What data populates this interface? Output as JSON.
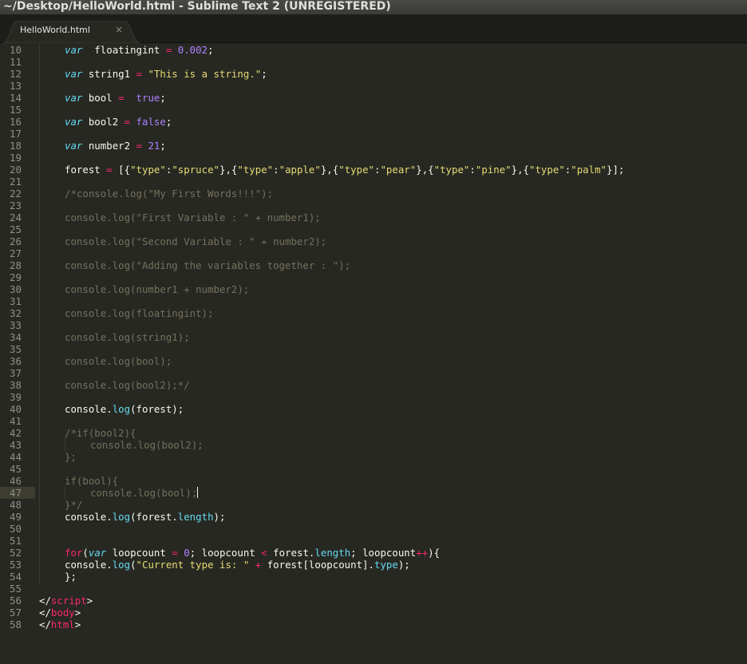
{
  "window": {
    "title": "~/Desktop/HelloWorld.html - Sublime Text 2 (UNREGISTERED)"
  },
  "tabs": [
    {
      "label": "HelloWorld.html",
      "close": "×"
    }
  ],
  "editor": {
    "active_line": 47,
    "lines": [
      {
        "n": "10",
        "indent": 1,
        "tokens": [
          [
            "kw-i",
            "var"
          ],
          [
            "",
            "  floatingint "
          ],
          [
            "op",
            "="
          ],
          [
            "",
            " "
          ],
          [
            "num",
            "0.002"
          ],
          [
            "",
            ";"
          ]
        ]
      },
      {
        "n": "11",
        "indent": 1,
        "tokens": []
      },
      {
        "n": "12",
        "indent": 1,
        "tokens": [
          [
            "kw-i",
            "var"
          ],
          [
            "",
            " string1 "
          ],
          [
            "op",
            "="
          ],
          [
            "",
            " "
          ],
          [
            "str",
            "\"This is a string.\""
          ],
          [
            "",
            ";"
          ]
        ]
      },
      {
        "n": "13",
        "indent": 1,
        "tokens": []
      },
      {
        "n": "14",
        "indent": 1,
        "tokens": [
          [
            "kw-i",
            "var"
          ],
          [
            "",
            " bool "
          ],
          [
            "op",
            "="
          ],
          [
            "",
            "  "
          ],
          [
            "con",
            "true"
          ],
          [
            "",
            ";"
          ]
        ]
      },
      {
        "n": "15",
        "indent": 1,
        "tokens": []
      },
      {
        "n": "16",
        "indent": 1,
        "tokens": [
          [
            "kw-i",
            "var"
          ],
          [
            "",
            " bool2 "
          ],
          [
            "op",
            "="
          ],
          [
            "",
            " "
          ],
          [
            "con",
            "false"
          ],
          [
            "",
            ";"
          ]
        ]
      },
      {
        "n": "17",
        "indent": 1,
        "tokens": []
      },
      {
        "n": "18",
        "indent": 1,
        "tokens": [
          [
            "kw-i",
            "var"
          ],
          [
            "",
            " number2 "
          ],
          [
            "op",
            "="
          ],
          [
            "",
            " "
          ],
          [
            "num",
            "21"
          ],
          [
            "",
            ";"
          ]
        ]
      },
      {
        "n": "19",
        "indent": 1,
        "tokens": []
      },
      {
        "n": "20",
        "indent": 1,
        "tokens": [
          [
            "",
            "forest "
          ],
          [
            "op",
            "="
          ],
          [
            "",
            " [{"
          ],
          [
            "str",
            "\"type\""
          ],
          [
            "",
            ":"
          ],
          [
            "str",
            "\"spruce\""
          ],
          [
            "",
            "},{"
          ],
          [
            "str",
            "\"type\""
          ],
          [
            "",
            ":"
          ],
          [
            "str",
            "\"apple\""
          ],
          [
            "",
            "},{"
          ],
          [
            "str",
            "\"type\""
          ],
          [
            "",
            ":"
          ],
          [
            "str",
            "\"pear\""
          ],
          [
            "",
            "},{"
          ],
          [
            "str",
            "\"type\""
          ],
          [
            "",
            ":"
          ],
          [
            "str",
            "\"pine\""
          ],
          [
            "",
            "},{"
          ],
          [
            "str",
            "\"type\""
          ],
          [
            "",
            ":"
          ],
          [
            "str",
            "\"palm\""
          ],
          [
            "",
            "}];"
          ]
        ]
      },
      {
        "n": "21",
        "indent": 1,
        "tokens": []
      },
      {
        "n": "22",
        "indent": 1,
        "tokens": [
          [
            "cm",
            "/*console.log(\"My First Words!!!\");"
          ]
        ]
      },
      {
        "n": "23",
        "indent": 1,
        "tokens": []
      },
      {
        "n": "24",
        "indent": 1,
        "tokens": [
          [
            "cm",
            "console.log(\"First Variable : \" + number1);"
          ]
        ]
      },
      {
        "n": "25",
        "indent": 1,
        "tokens": []
      },
      {
        "n": "26",
        "indent": 1,
        "tokens": [
          [
            "cm",
            "console.log(\"Second Variable : \" + number2);"
          ]
        ]
      },
      {
        "n": "27",
        "indent": 1,
        "tokens": []
      },
      {
        "n": "28",
        "indent": 1,
        "tokens": [
          [
            "cm",
            "console.log(\"Adding the variables together : \");"
          ]
        ]
      },
      {
        "n": "29",
        "indent": 1,
        "tokens": []
      },
      {
        "n": "30",
        "indent": 1,
        "tokens": [
          [
            "cm",
            "console.log(number1 + number2);"
          ]
        ]
      },
      {
        "n": "31",
        "indent": 1,
        "tokens": []
      },
      {
        "n": "32",
        "indent": 1,
        "tokens": [
          [
            "cm",
            "console.log(floatingint);"
          ]
        ]
      },
      {
        "n": "33",
        "indent": 1,
        "tokens": []
      },
      {
        "n": "34",
        "indent": 1,
        "tokens": [
          [
            "cm",
            "console.log(string1);"
          ]
        ]
      },
      {
        "n": "35",
        "indent": 1,
        "tokens": []
      },
      {
        "n": "36",
        "indent": 1,
        "tokens": [
          [
            "cm",
            "console.log(bool);"
          ]
        ]
      },
      {
        "n": "37",
        "indent": 1,
        "tokens": []
      },
      {
        "n": "38",
        "indent": 1,
        "tokens": [
          [
            "cm",
            "console.log(bool2);*/"
          ]
        ]
      },
      {
        "n": "39",
        "indent": 1,
        "tokens": []
      },
      {
        "n": "40",
        "indent": 1,
        "tokens": [
          [
            "",
            "console."
          ],
          [
            "fn",
            "log"
          ],
          [
            "",
            "(forest);"
          ]
        ]
      },
      {
        "n": "41",
        "indent": 1,
        "tokens": []
      },
      {
        "n": "42",
        "indent": 1,
        "tokens": [
          [
            "cm",
            "/*if(bool2){"
          ]
        ]
      },
      {
        "n": "43",
        "indent": 2,
        "tokens": [
          [
            "cm",
            "console.log(bool2);"
          ]
        ]
      },
      {
        "n": "44",
        "indent": 1,
        "tokens": [
          [
            "cm",
            "};"
          ]
        ]
      },
      {
        "n": "45",
        "indent": 1,
        "tokens": []
      },
      {
        "n": "46",
        "indent": 1,
        "tokens": [
          [
            "cm",
            "if(bool){"
          ]
        ]
      },
      {
        "n": "47",
        "indent": 2,
        "tokens": [
          [
            "cm",
            "console.log(bool);"
          ]
        ],
        "caret": true
      },
      {
        "n": "48",
        "indent": 1,
        "tokens": [
          [
            "cm",
            "}*/"
          ]
        ]
      },
      {
        "n": "49",
        "indent": 1,
        "tokens": [
          [
            "",
            "console."
          ],
          [
            "fn",
            "log"
          ],
          [
            "",
            "(forest."
          ],
          [
            "fn",
            "length"
          ],
          [
            "",
            ");"
          ]
        ]
      },
      {
        "n": "50",
        "indent": 1,
        "tokens": []
      },
      {
        "n": "51",
        "indent": 1,
        "tokens": []
      },
      {
        "n": "52",
        "indent": 1,
        "tokens": [
          [
            "kw",
            "for"
          ],
          [
            "",
            "("
          ],
          [
            "kw-i",
            "var"
          ],
          [
            "",
            " loopcount "
          ],
          [
            "op",
            "="
          ],
          [
            "",
            " "
          ],
          [
            "num",
            "0"
          ],
          [
            "",
            "; loopcount "
          ],
          [
            "op",
            "<"
          ],
          [
            "",
            " forest."
          ],
          [
            "fn",
            "length"
          ],
          [
            "",
            "; loopcount"
          ],
          [
            "op",
            "++"
          ],
          [
            "",
            "){"
          ]
        ]
      },
      {
        "n": "53",
        "indent": 1,
        "tokens": [
          [
            "",
            "console."
          ],
          [
            "fn",
            "log"
          ],
          [
            "",
            "("
          ],
          [
            "str",
            "\"Current type is: \""
          ],
          [
            "",
            " "
          ],
          [
            "op",
            "+"
          ],
          [
            "",
            " forest[loopcount]."
          ],
          [
            "fn",
            "type"
          ],
          [
            "",
            ");"
          ]
        ]
      },
      {
        "n": "54",
        "indent": 1,
        "tokens": [
          [
            "",
            "};"
          ]
        ]
      },
      {
        "n": "55",
        "indent": 0,
        "tokens": []
      },
      {
        "n": "56",
        "indent": 0,
        "tokens": [
          [
            "",
            "</"
          ],
          [
            "tag",
            "script"
          ],
          [
            "",
            ">"
          ]
        ]
      },
      {
        "n": "57",
        "indent": 0,
        "tokens": [
          [
            "",
            "</"
          ],
          [
            "tag",
            "body"
          ],
          [
            "",
            ">"
          ]
        ]
      },
      {
        "n": "58",
        "indent": 0,
        "tokens": [
          [
            "",
            "</"
          ],
          [
            "tag",
            "html"
          ],
          [
            "",
            ">"
          ]
        ]
      }
    ]
  }
}
